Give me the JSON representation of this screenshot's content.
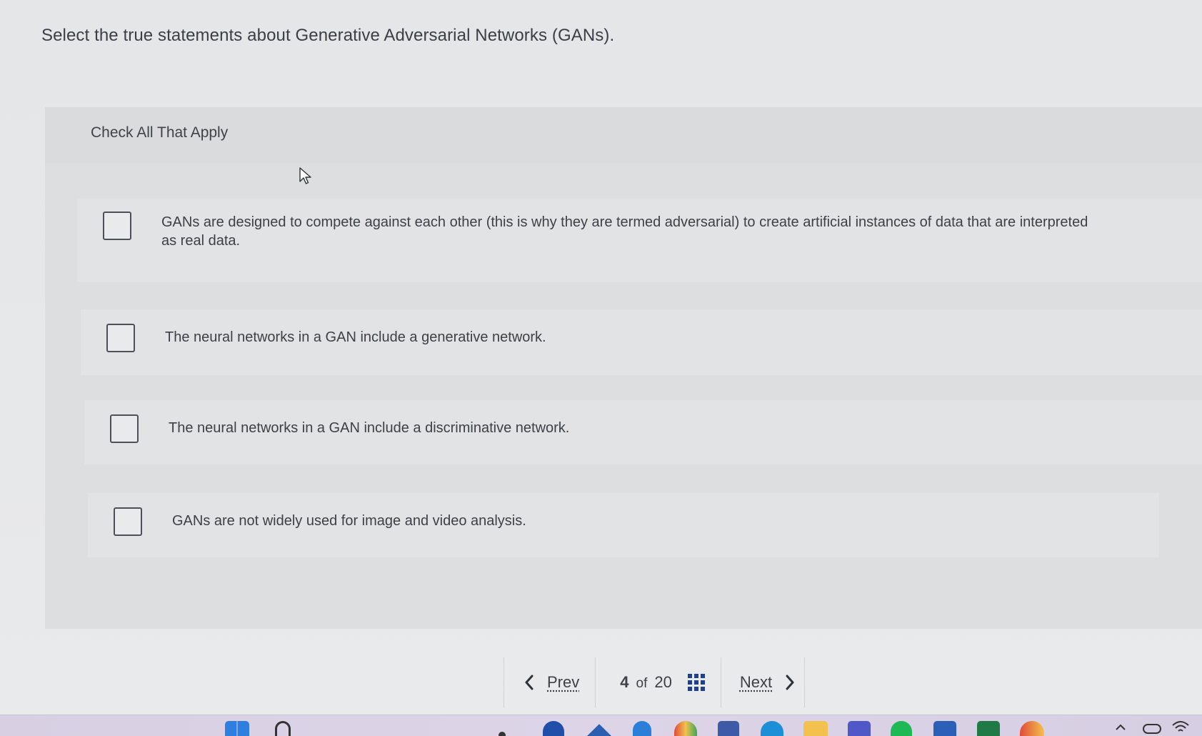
{
  "question": {
    "text": "Select the true statements about Generative Adversarial Networks (GANs)."
  },
  "panel": {
    "title": "Check All That Apply",
    "options": [
      {
        "label": "GANs are designed to compete against each other (this is why they are termed adversarial) to create artificial instances of data that are interpreted as real data.",
        "checked": false
      },
      {
        "label": "The neural networks in a GAN include a generative network.",
        "checked": false
      },
      {
        "label": "The neural networks in a GAN include a discriminative network.",
        "checked": false
      },
      {
        "label": "GANs are not widely used for image and video analysis.",
        "checked": false
      }
    ]
  },
  "pager": {
    "prev_label": "Prev",
    "current": "4",
    "of_label": "of",
    "total": "20",
    "next_label": "Next",
    "prev_icon": "chevron-left-icon",
    "next_icon": "chevron-right-icon",
    "grid_icon": "question-grid-icon"
  },
  "taskbar": {
    "icons": [
      "start-icon",
      "search-icon",
      "copilot-icon",
      "mail-icon",
      "edge-icon",
      "chrome-icon",
      "store-icon",
      "browser-icon",
      "file-explorer-icon",
      "teams-icon",
      "spotify-icon",
      "word-icon",
      "excel-icon",
      "chrome-canary-icon",
      "chevron-up-icon",
      "onedrive-icon",
      "wifi-icon"
    ],
    "colors": {
      "accent": "#1f3f8f",
      "word": "#2b5fb8",
      "excel": "#1f7a45",
      "spotify": "#1db954",
      "teams": "#5058c8",
      "folder": "#f2c14e"
    }
  }
}
